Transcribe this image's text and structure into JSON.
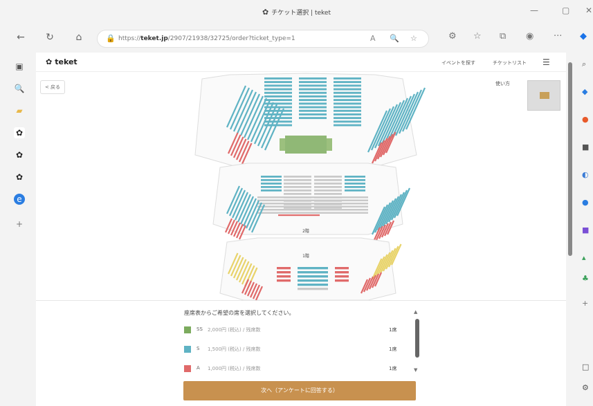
{
  "window": {
    "title": "チケット選択 | teket",
    "controls": {
      "minimize": "—",
      "maximize": "▢",
      "close": "✕"
    }
  },
  "browser": {
    "back_icon": "←",
    "refresh_icon": "↻",
    "home_icon": "⌂",
    "lock_icon": "🔒",
    "url_prefix": "https://",
    "url_domain": "teket.jp",
    "url_path": "/2907/21938/32725/order?ticket_type=1",
    "right_icons": [
      "A",
      "🔍",
      "☆",
      "⚙",
      "☆",
      "⧉",
      "◉",
      "···"
    ]
  },
  "site": {
    "brand": "teket",
    "header_links": [
      "イベントを探す",
      "チケットリスト"
    ],
    "menu_icon": "☰",
    "back_label": "< 戻る",
    "usage_label": "使い方"
  },
  "seatmap": {
    "floor_label_2": "2階",
    "floor_label_1": "1階"
  },
  "panel": {
    "prompt": "座席表からご希望の席を選択してください。",
    "seats": [
      {
        "rank": "SS",
        "price": "2,000円 (税込) / 残席数",
        "available": "1席",
        "color": "#7cab5e"
      },
      {
        "rank": "S",
        "price": "1,500円 (税込) / 残席数",
        "available": "1席",
        "color": "#5fb3c4"
      },
      {
        "rank": "A",
        "price": "1,000円 (税込) / 残席数",
        "available": "1席",
        "color": "#e06a6a"
      }
    ],
    "next_button": "次へ（アンケートに回答する）"
  },
  "colors": {
    "accent": "#c8914f",
    "ss": "#7cab5e",
    "s": "#5fb3c4",
    "a": "#e06a6a",
    "b": "#e8d36a",
    "unavailable": "#c9c9c9"
  }
}
